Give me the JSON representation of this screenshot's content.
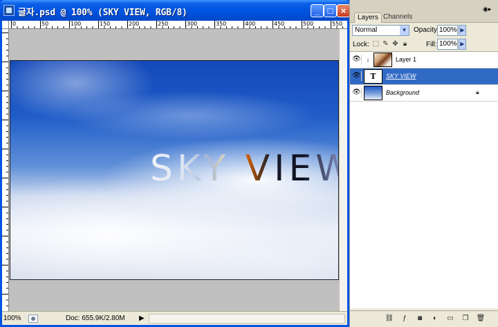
{
  "document": {
    "title": "글자.psd @ 100% (SKY VIEW, RGB/8)",
    "canvas_text": "SKY VIEW",
    "ruler_labels": [
      "0",
      "50",
      "100",
      "150",
      "200",
      "250",
      "300",
      "350",
      "400",
      "450",
      "500",
      "550"
    ],
    "status": {
      "zoom": "100%",
      "doc_info": "Doc: 655.9K/2.80M"
    }
  },
  "layers_panel": {
    "tabs": [
      {
        "label": "Layers",
        "active": true
      },
      {
        "label": "Channels",
        "active": false
      }
    ],
    "blend_mode": "Normal",
    "opacity_label": "Opacity:",
    "opacity_value": "100%",
    "lock_label": "Lock:",
    "fill_label": "Fill:",
    "fill_value": "100%",
    "layers": [
      {
        "name": "Layer 1",
        "visible": true,
        "clipped": true,
        "selected": false,
        "type": "image"
      },
      {
        "name": "SKY VIEW",
        "visible": true,
        "clipped": false,
        "selected": true,
        "type": "text",
        "thumb_glyph": "T"
      },
      {
        "name": "Background",
        "visible": true,
        "clipped": false,
        "selected": false,
        "type": "image",
        "locked": true
      }
    ]
  },
  "colors": {
    "titlebar": "#0054e3",
    "selection": "#316ac5",
    "panel_bg": "#ece9d8"
  }
}
